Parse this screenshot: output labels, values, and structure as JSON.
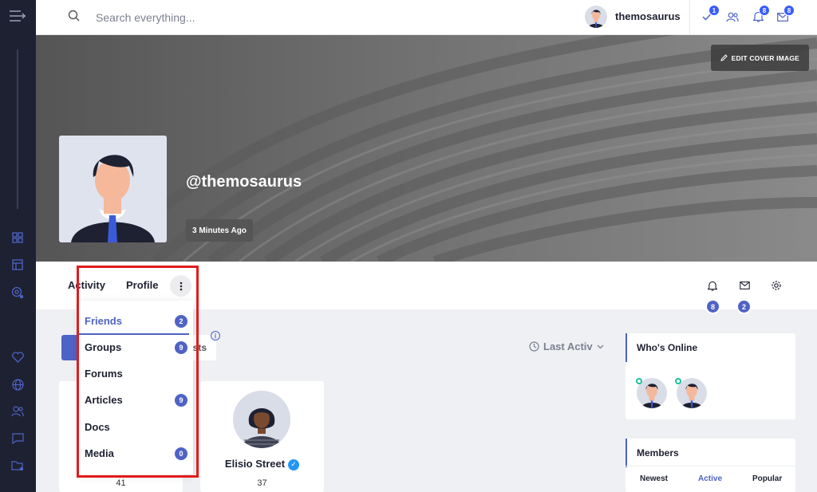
{
  "search": {
    "placeholder": "Search everything..."
  },
  "header": {
    "username": "themosaurus",
    "badges": {
      "tasks": "1",
      "notifications": "8",
      "messages": "8"
    }
  },
  "cover": {
    "edit_label": "EDIT COVER IMAGE"
  },
  "profile": {
    "handle": "@themosaurus",
    "last_active": "3 Minutes Ago"
  },
  "nav": {
    "tabs": [
      "Activity",
      "Profile"
    ],
    "badges": {
      "notifications": "8",
      "messages": "2"
    }
  },
  "dropdown": {
    "items": [
      {
        "label": "Friends",
        "count": "2"
      },
      {
        "label": "Groups",
        "count": "9"
      },
      {
        "label": "Forums",
        "count": ""
      },
      {
        "label": "Articles",
        "count": "9"
      },
      {
        "label": "Docs",
        "count": ""
      },
      {
        "label": "Media",
        "count": "0"
      }
    ]
  },
  "filter": {
    "tail_text": "ests",
    "info": "i"
  },
  "sort": {
    "label": "Last Activ"
  },
  "members": [
    {
      "name": "",
      "count": "41"
    },
    {
      "name": "Elisio Street",
      "count": "37"
    }
  ],
  "whos_online": {
    "title": "Who's Online"
  },
  "members_widget": {
    "title": "Members",
    "tabs": [
      "Newest",
      "Active",
      "Popular"
    ],
    "active_tab": "Active"
  },
  "colors": {
    "accent": "#4e63c5",
    "sidebar": "#1e2132",
    "highlight": "#e31b1b"
  }
}
